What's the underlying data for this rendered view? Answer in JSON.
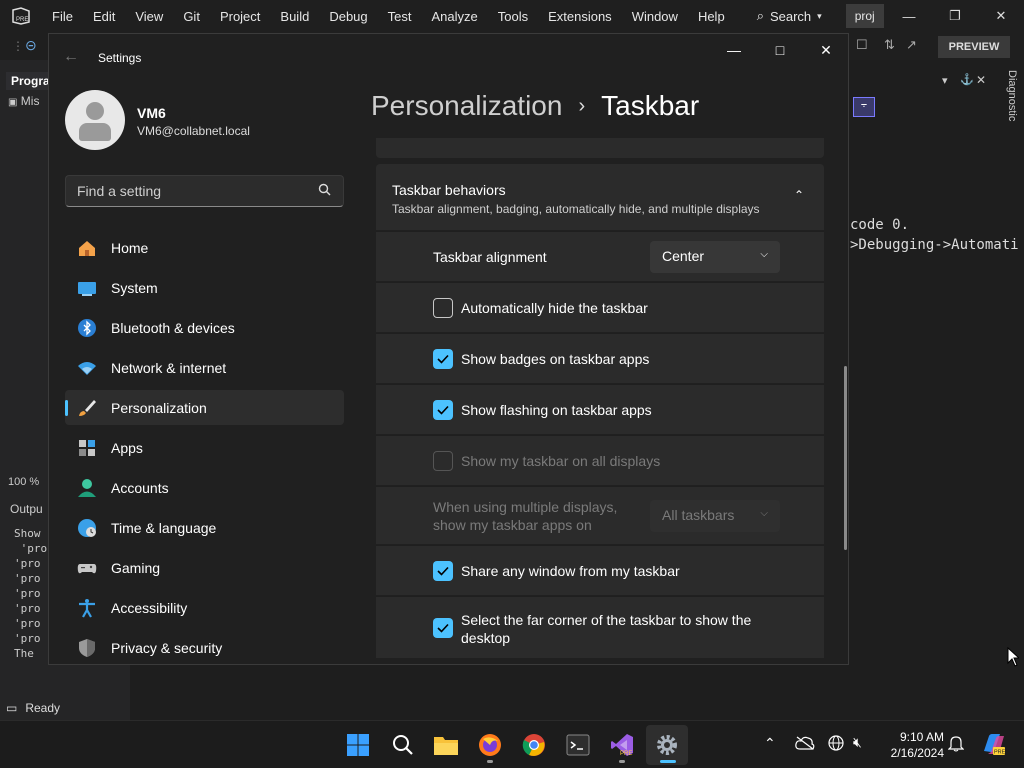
{
  "vs": {
    "menu": [
      "File",
      "Edit",
      "View",
      "Git",
      "Project",
      "Build",
      "Debug",
      "Test",
      "Analyze",
      "Tools",
      "Extensions",
      "Window",
      "Help"
    ],
    "search": "Search",
    "project": "proj",
    "preview": "PREVIEW",
    "left_tab": "Progra",
    "left_sub": "Mis",
    "zoom": "100 %",
    "output_title": "Outpu",
    "output_lines": [
      "Show",
      " 'pro",
      "'pro",
      "'pro",
      "'pro",
      "'pro",
      "'pro",
      "'pro",
      "The "
    ],
    "console_lines": [
      "code 0.",
      ">Debugging->Automati"
    ],
    "diagnostics": "Diagnostic",
    "status": "Ready"
  },
  "settings": {
    "title": "Settings",
    "user": {
      "name": "VM6",
      "email": "VM6@collabnet.local"
    },
    "search_placeholder": "Find a setting",
    "nav": [
      {
        "label": "Home",
        "icon": "home-icon"
      },
      {
        "label": "System",
        "icon": "system-icon"
      },
      {
        "label": "Bluetooth & devices",
        "icon": "bluetooth-icon"
      },
      {
        "label": "Network & internet",
        "icon": "wifi-icon"
      },
      {
        "label": "Personalization",
        "icon": "brush-icon",
        "selected": true
      },
      {
        "label": "Apps",
        "icon": "apps-icon"
      },
      {
        "label": "Accounts",
        "icon": "accounts-icon"
      },
      {
        "label": "Time & language",
        "icon": "globe-icon"
      },
      {
        "label": "Gaming",
        "icon": "gamepad-icon"
      },
      {
        "label": "Accessibility",
        "icon": "accessibility-icon"
      },
      {
        "label": "Privacy & security",
        "icon": "shield-icon"
      }
    ],
    "breadcrumb": {
      "parent": "Personalization",
      "current": "Taskbar"
    },
    "section": {
      "title": "Taskbar behaviors",
      "description": "Taskbar alignment, badging, automatically hide, and multiple displays"
    },
    "alignment": {
      "label": "Taskbar alignment",
      "value": "Center"
    },
    "options": [
      {
        "label": "Automatically hide the taskbar",
        "checked": false,
        "disabled": false
      },
      {
        "label": "Show badges on taskbar apps",
        "checked": true,
        "disabled": false
      },
      {
        "label": "Show flashing on taskbar apps",
        "checked": true,
        "disabled": false
      },
      {
        "label": "Show my taskbar on all displays",
        "checked": false,
        "disabled": true
      }
    ],
    "multi_display": {
      "label_line1": "When using multiple displays,",
      "label_line2": "show my taskbar apps on",
      "value": "All taskbars"
    },
    "options2": [
      {
        "label": "Share any window from my taskbar",
        "checked": true
      },
      {
        "label_line1": "Select the far corner of the taskbar to show the",
        "label_line2": "desktop",
        "checked": true
      }
    ]
  },
  "taskbar": {
    "time": "9:10 AM",
    "date": "2/16/2024",
    "colors": {
      "accent": "#4cc2ff",
      "windows": "#3aa0ff"
    }
  }
}
